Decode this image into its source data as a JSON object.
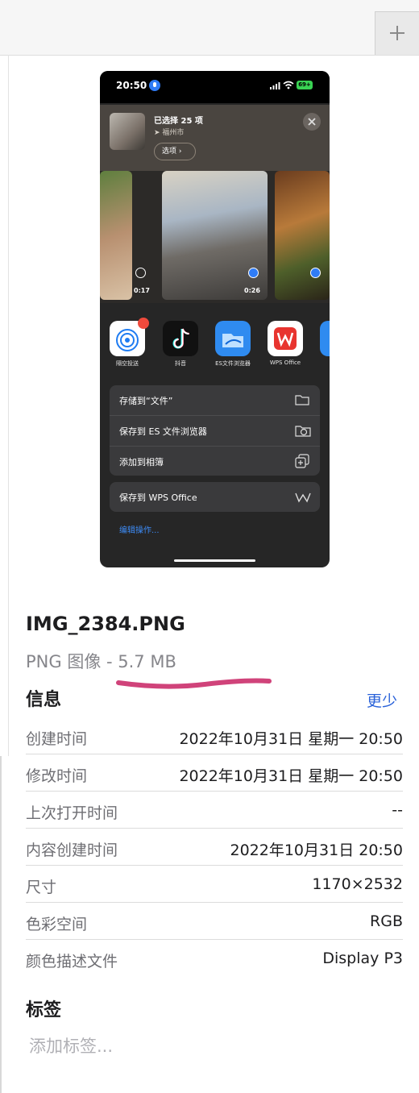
{
  "toolbar": {
    "add_icon": "plus-icon"
  },
  "phone": {
    "status_time": "20:50",
    "battery": "69+",
    "selection_title": "已选择 25 项",
    "selection_location": "福州市",
    "options_label": "选项",
    "videos": [
      {
        "duration": "0:17",
        "selected": false
      },
      {
        "duration": "0:26",
        "selected": true
      },
      {
        "duration": "",
        "selected": true
      }
    ],
    "apps": [
      {
        "label": "隔空投送",
        "color": "#ffffff"
      },
      {
        "label": "抖音",
        "color": "#111111"
      },
      {
        "label": "ES文件浏览器",
        "color": "#2f8bf0"
      },
      {
        "label": "WPS Office",
        "color": "#ffffff"
      }
    ],
    "menu": [
      {
        "label": "存储到“文件”",
        "icon": "folder-icon"
      },
      {
        "label": "保存到 ES 文件浏览器",
        "icon": "es-folder-icon"
      },
      {
        "label": "添加到相簿",
        "icon": "add-album-icon"
      }
    ],
    "menu_wps": {
      "label": "保存到 WPS Office",
      "icon": "wps-icon"
    },
    "edit_actions": "编辑操作..."
  },
  "file": {
    "name": "IMG_2384.PNG",
    "subtitle": "PNG 图像 - 5.7 MB"
  },
  "info": {
    "heading": "信息",
    "toggle": "更少",
    "rows": [
      {
        "key": "创建时间",
        "value": "2022年10月31日 星期一 20:50"
      },
      {
        "key": "修改时间",
        "value": "2022年10月31日 星期一 20:50"
      },
      {
        "key": "上次打开时间",
        "value": "--"
      },
      {
        "key": "内容创建时间",
        "value": "2022年10月31日 20:50"
      },
      {
        "key": "尺寸",
        "value": "1170×2532"
      },
      {
        "key": "色彩空间",
        "value": "RGB"
      },
      {
        "key": "颜色描述文件",
        "value": "Display P3"
      }
    ]
  },
  "tags": {
    "heading": "标签",
    "placeholder": "添加标签..."
  },
  "colors": {
    "accent": "#2a62d9",
    "underline": "#d0437a"
  }
}
